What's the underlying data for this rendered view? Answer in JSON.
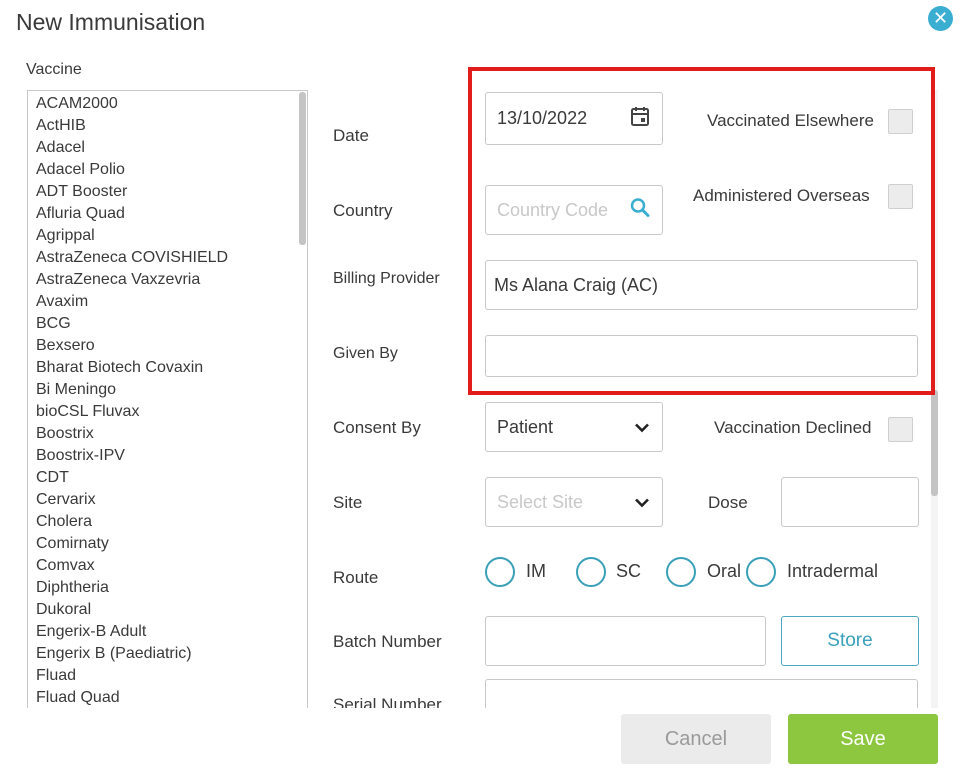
{
  "dialog": {
    "title": "New Immunisation",
    "close_icon": "close-icon"
  },
  "vaccine": {
    "label": "Vaccine",
    "items": [
      "ACAM2000",
      "ActHIB",
      "Adacel",
      "Adacel Polio",
      "ADT Booster",
      "Afluria Quad",
      "Agrippal",
      "AstraZeneca COVISHIELD",
      "AstraZeneca Vaxzevria",
      "Avaxim",
      "BCG",
      "Bexsero",
      "Bharat Biotech Covaxin",
      "Bi Meningo",
      "bioCSL Fluvax",
      "Boostrix",
      "Boostrix-IPV",
      "CDT",
      "Cervarix",
      "Cholera",
      "Comirnaty",
      "Comvax",
      "Diphtheria",
      "Dukoral",
      "Engerix-B Adult",
      "Engerix B (Paediatric)",
      "Fluad",
      "Fluad Quad"
    ]
  },
  "form": {
    "date": {
      "label": "Date",
      "value": "13/10/2022",
      "icon": "calendar-icon"
    },
    "vaccinated_elsewhere": {
      "label": "Vaccinated Elsewhere",
      "checked": false
    },
    "country": {
      "label": "Country",
      "placeholder": "Country Code",
      "icon": "search-icon"
    },
    "administered_overseas": {
      "label": "Administered Overseas",
      "checked": false
    },
    "billing_provider": {
      "label": "Billing Provider",
      "value": "Ms Alana Craig (AC)"
    },
    "given_by": {
      "label": "Given By",
      "value": ""
    },
    "consent_by": {
      "label": "Consent By",
      "value": "Patient",
      "icon": "chevron-down-icon"
    },
    "vaccination_declined": {
      "label": "Vaccination Declined",
      "checked": false
    },
    "site": {
      "label": "Site",
      "placeholder": "Select Site",
      "icon": "chevron-down-icon"
    },
    "dose": {
      "label": "Dose",
      "value": ""
    },
    "route": {
      "label": "Route",
      "options": [
        "IM",
        "SC",
        "Oral",
        "Intradermal"
      ]
    },
    "batch_number": {
      "label": "Batch Number",
      "value": ""
    },
    "store_label": "Store",
    "serial_number": {
      "label": "Serial Number",
      "value": ""
    }
  },
  "footer": {
    "cancel_label": "Cancel",
    "save_label": "Save"
  },
  "colors": {
    "accent": "#3aaed1",
    "highlight": "#e21b1b",
    "save": "#8dc63f",
    "cancel": "#ebebeb"
  }
}
